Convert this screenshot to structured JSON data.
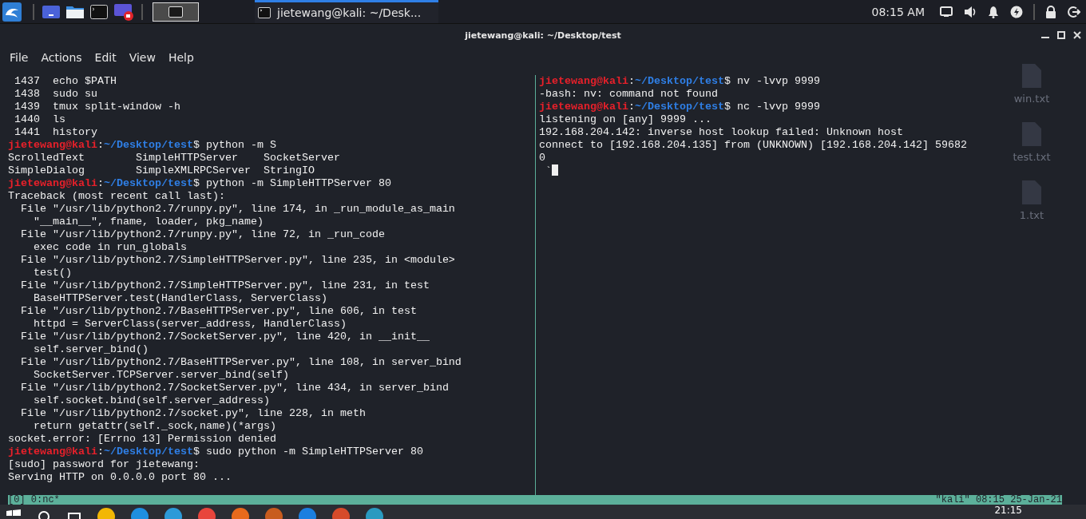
{
  "top_panel": {
    "workspaces": [
      {
        "selected": true
      }
    ],
    "task": {
      "title": "jietewang@kali: ~/Desk...",
      "active": true
    },
    "clock": "08:15 AM"
  },
  "window": {
    "title": "jietewang@kali: ~/Desktop/test"
  },
  "menu": [
    "File",
    "Actions",
    "Edit",
    "View",
    "Help"
  ],
  "desktop_icons": [
    {
      "label": "win.txt"
    },
    {
      "label": "test.txt"
    },
    {
      "label": "1.txt"
    }
  ],
  "panes": [
    {
      "cursor": false,
      "lines": [
        [
          {
            "kind": "plain",
            "text": " 1437  echo $PATH"
          }
        ],
        [
          {
            "kind": "plain",
            "text": " 1438  sudo su"
          }
        ],
        [
          {
            "kind": "plain",
            "text": " 1439  tmux split-window -h"
          }
        ],
        [
          {
            "kind": "plain",
            "text": " 1440  ls"
          }
        ],
        [
          {
            "kind": "plain",
            "text": " 1441  history"
          }
        ],
        [
          {
            "kind": "user",
            "text": "jietewang@kali"
          },
          {
            "kind": "plain",
            "text": ":"
          },
          {
            "kind": "path",
            "text": "~/Desktop/test"
          },
          {
            "kind": "plain",
            "text": "$ python -m S"
          }
        ],
        [
          {
            "kind": "plain",
            "text": "ScrolledText        SimpleHTTPServer    SocketServer"
          }
        ],
        [
          {
            "kind": "plain",
            "text": "SimpleDialog        SimpleXMLRPCServer  StringIO"
          }
        ],
        [
          {
            "kind": "user",
            "text": "jietewang@kali"
          },
          {
            "kind": "plain",
            "text": ":"
          },
          {
            "kind": "path",
            "text": "~/Desktop/test"
          },
          {
            "kind": "plain",
            "text": "$ python -m SimpleHTTPServer 80"
          }
        ],
        [
          {
            "kind": "plain",
            "text": "Traceback (most recent call last):"
          }
        ],
        [
          {
            "kind": "plain",
            "text": "  File \"/usr/lib/python2.7/runpy.py\", line 174, in _run_module_as_main"
          }
        ],
        [
          {
            "kind": "plain",
            "text": "    \"__main__\", fname, loader, pkg_name)"
          }
        ],
        [
          {
            "kind": "plain",
            "text": "  File \"/usr/lib/python2.7/runpy.py\", line 72, in _run_code"
          }
        ],
        [
          {
            "kind": "plain",
            "text": "    exec code in run_globals"
          }
        ],
        [
          {
            "kind": "plain",
            "text": "  File \"/usr/lib/python2.7/SimpleHTTPServer.py\", line 235, in <module>"
          }
        ],
        [
          {
            "kind": "plain",
            "text": "    test()"
          }
        ],
        [
          {
            "kind": "plain",
            "text": "  File \"/usr/lib/python2.7/SimpleHTTPServer.py\", line 231, in test"
          }
        ],
        [
          {
            "kind": "plain",
            "text": "    BaseHTTPServer.test(HandlerClass, ServerClass)"
          }
        ],
        [
          {
            "kind": "plain",
            "text": "  File \"/usr/lib/python2.7/BaseHTTPServer.py\", line 606, in test"
          }
        ],
        [
          {
            "kind": "plain",
            "text": "    httpd = ServerClass(server_address, HandlerClass)"
          }
        ],
        [
          {
            "kind": "plain",
            "text": "  File \"/usr/lib/python2.7/SocketServer.py\", line 420, in __init__"
          }
        ],
        [
          {
            "kind": "plain",
            "text": "    self.server_bind()"
          }
        ],
        [
          {
            "kind": "plain",
            "text": "  File \"/usr/lib/python2.7/BaseHTTPServer.py\", line 108, in server_bind"
          }
        ],
        [
          {
            "kind": "plain",
            "text": "    SocketServer.TCPServer.server_bind(self)"
          }
        ],
        [
          {
            "kind": "plain",
            "text": "  File \"/usr/lib/python2.7/SocketServer.py\", line 434, in server_bind"
          }
        ],
        [
          {
            "kind": "plain",
            "text": "    self.socket.bind(self.server_address)"
          }
        ],
        [
          {
            "kind": "plain",
            "text": "  File \"/usr/lib/python2.7/socket.py\", line 228, in meth"
          }
        ],
        [
          {
            "kind": "plain",
            "text": "    return getattr(self._sock,name)(*args)"
          }
        ],
        [
          {
            "kind": "plain",
            "text": "socket.error: [Errno 13] Permission denied"
          }
        ],
        [
          {
            "kind": "user",
            "text": "jietewang@kali"
          },
          {
            "kind": "plain",
            "text": ":"
          },
          {
            "kind": "path",
            "text": "~/Desktop/test"
          },
          {
            "kind": "plain",
            "text": "$ sudo python -m SimpleHTTPServer 80"
          }
        ],
        [
          {
            "kind": "plain",
            "text": "[sudo] password for jietewang:"
          }
        ],
        [
          {
            "kind": "plain",
            "text": "Serving HTTP on 0.0.0.0 port 80 ..."
          }
        ]
      ]
    },
    {
      "cursor": true,
      "lines": [
        [
          {
            "kind": "user",
            "text": "jietewang@kali"
          },
          {
            "kind": "plain",
            "text": ":"
          },
          {
            "kind": "path",
            "text": "~/Desktop/test"
          },
          {
            "kind": "plain",
            "text": "$ nv -lvvp 9999"
          }
        ],
        [
          {
            "kind": "plain",
            "text": "-bash: nv: command not found"
          }
        ],
        [
          {
            "kind": "user",
            "text": "jietewang@kali"
          },
          {
            "kind": "plain",
            "text": ":"
          },
          {
            "kind": "path",
            "text": "~/Desktop/test"
          },
          {
            "kind": "plain",
            "text": "$ nc -lvvp 9999"
          }
        ],
        [
          {
            "kind": "plain",
            "text": "listening on [any] 9999 ..."
          }
        ],
        [
          {
            "kind": "plain",
            "text": "192.168.204.142: inverse host lookup failed: Unknown host"
          }
        ],
        [
          {
            "kind": "plain",
            "text": "connect to [192.168.204.135] from (UNKNOWN) [192.168.204.142] 59682"
          }
        ],
        [
          {
            "kind": "plain",
            "text": "0"
          }
        ],
        [
          {
            "kind": "plain",
            "text": " `"
          }
        ]
      ]
    }
  ],
  "status_bar": {
    "left": "[0] 0:nc*",
    "right": "\"kali\" 08:15 25-Jan-21"
  },
  "windows_taskbar": {
    "clock": "21:15"
  }
}
